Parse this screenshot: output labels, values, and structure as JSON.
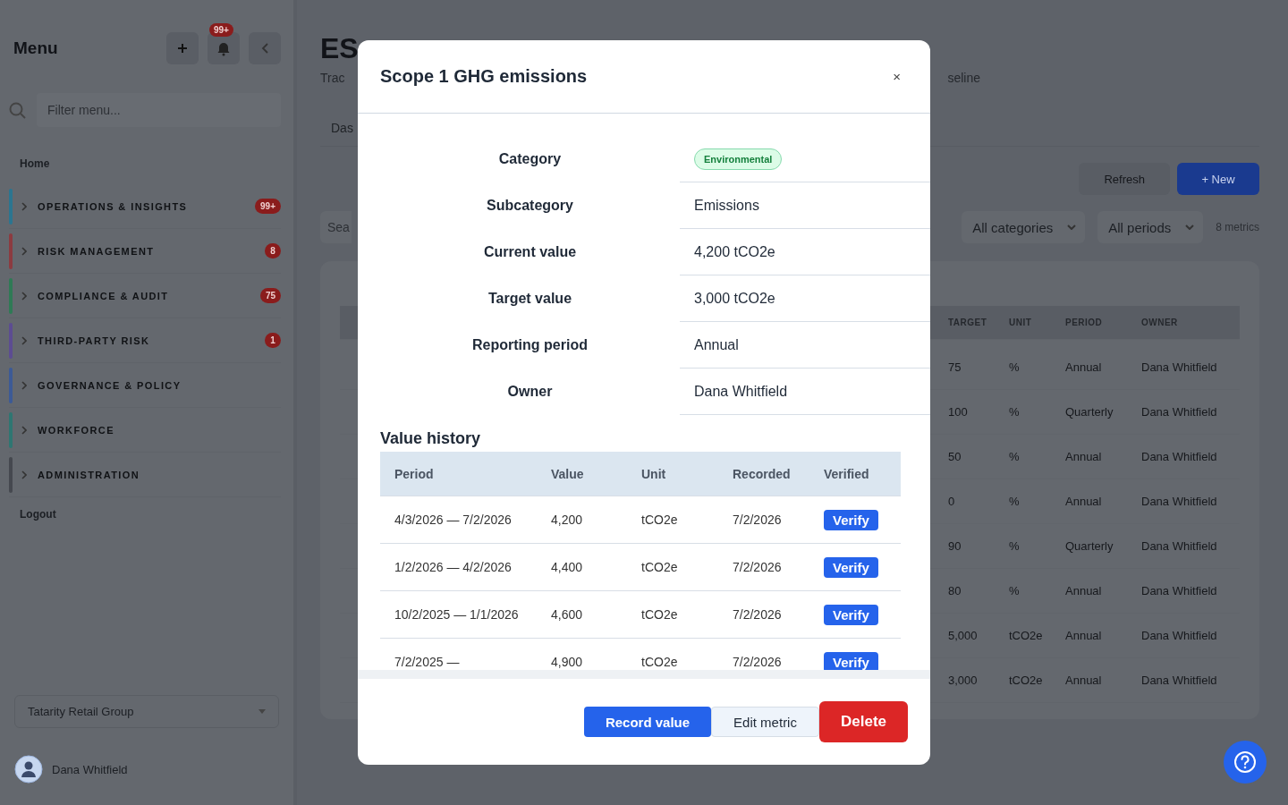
{
  "sidebar": {
    "title": "Menu",
    "notification_count": "99+",
    "filter_placeholder": "Filter menu...",
    "home": "Home",
    "sections": [
      {
        "label": "OPERATIONS & INSIGHTS",
        "color": "#2b7590",
        "badge": "99+"
      },
      {
        "label": "RISK MANAGEMENT",
        "color": "#8c3b40",
        "badge": "8"
      },
      {
        "label": "COMPLIANCE & AUDIT",
        "color": "#2f7a55",
        "badge": "75"
      },
      {
        "label": "THIRD-PARTY RISK",
        "color": "#5c4c92",
        "badge": "1"
      },
      {
        "label": "GOVERNANCE & POLICY",
        "color": "#3c5a96"
      },
      {
        "label": "WORKFORCE",
        "color": "#2e7672"
      },
      {
        "label": "ADMINISTRATION",
        "color": "#45484f"
      }
    ],
    "logout": "Logout",
    "organization": "Tatarity Retail Group",
    "user": "Dana Whitfield"
  },
  "page": {
    "title": "ES",
    "subtitle_start": "Trac",
    "subtitle_end": "seline",
    "tab": "Das",
    "search_placeholder": "Sea",
    "refresh": "Refresh",
    "new": "+ New",
    "filters": [
      "All categories",
      "All periods"
    ],
    "count": "8 metrics",
    "table": {
      "columns": [
        "TARGET",
        "UNIT",
        "PERIOD",
        "OWNER"
      ],
      "rows": [
        [
          "75",
          "%",
          "Annual",
          "Dana Whitfield"
        ],
        [
          "100",
          "%",
          "Quarterly",
          "Dana Whitfield"
        ],
        [
          "50",
          "%",
          "Annual",
          "Dana Whitfield"
        ],
        [
          "0",
          "%",
          "Annual",
          "Dana Whitfield"
        ],
        [
          "90",
          "%",
          "Quarterly",
          "Dana Whitfield"
        ],
        [
          "80",
          "%",
          "Annual",
          "Dana Whitfield"
        ],
        [
          "5,000",
          "tCO2e",
          "Annual",
          "Dana Whitfield"
        ],
        [
          "3,000",
          "tCO2e",
          "Annual",
          "Dana Whitfield"
        ]
      ]
    }
  },
  "modal": {
    "title": "Scope 1 GHG emissions",
    "close": "×",
    "details": [
      {
        "label": "Category",
        "value": "Environmental",
        "kind": "badge"
      },
      {
        "label": "Subcategory",
        "value": "Emissions",
        "kind": "text"
      },
      {
        "label": "Current value",
        "value": "4,200 tCO2e",
        "kind": "text"
      },
      {
        "label": "Target value",
        "value": "3,000 tCO2e",
        "kind": "text"
      },
      {
        "label": "Reporting period",
        "value": "Annual",
        "kind": "text"
      },
      {
        "label": "Owner",
        "value": "Dana Whitfield",
        "kind": "text"
      }
    ],
    "history_title": "Value history",
    "history": {
      "columns": [
        "Period",
        "Value",
        "Unit",
        "Recorded",
        "Verified"
      ],
      "rows": [
        {
          "period": "4/3/2026 — 7/2/2026",
          "value": "4,200",
          "unit": "tCO2e",
          "recorded": "7/2/2026",
          "verified": false,
          "action": "Verify"
        },
        {
          "period": "1/2/2026 — 4/2/2026",
          "value": "4,400",
          "unit": "tCO2e",
          "recorded": "7/2/2026",
          "verified": false,
          "action": "Verify"
        },
        {
          "period": "10/2/2025 — 1/1/2026",
          "value": "4,600",
          "unit": "tCO2e",
          "recorded": "7/2/2026",
          "verified": false,
          "action": "Verify"
        },
        {
          "period": "7/2/2025 —",
          "value": "4,900",
          "unit": "tCO2e",
          "recorded": "7/2/2026",
          "verified": false,
          "action": "Verify"
        }
      ]
    },
    "buttons": [
      {
        "label": "Record value",
        "kind": "primary"
      },
      {
        "label": "Edit metric",
        "kind": "secondary"
      },
      {
        "label": "Delete",
        "kind": "danger"
      }
    ]
  }
}
